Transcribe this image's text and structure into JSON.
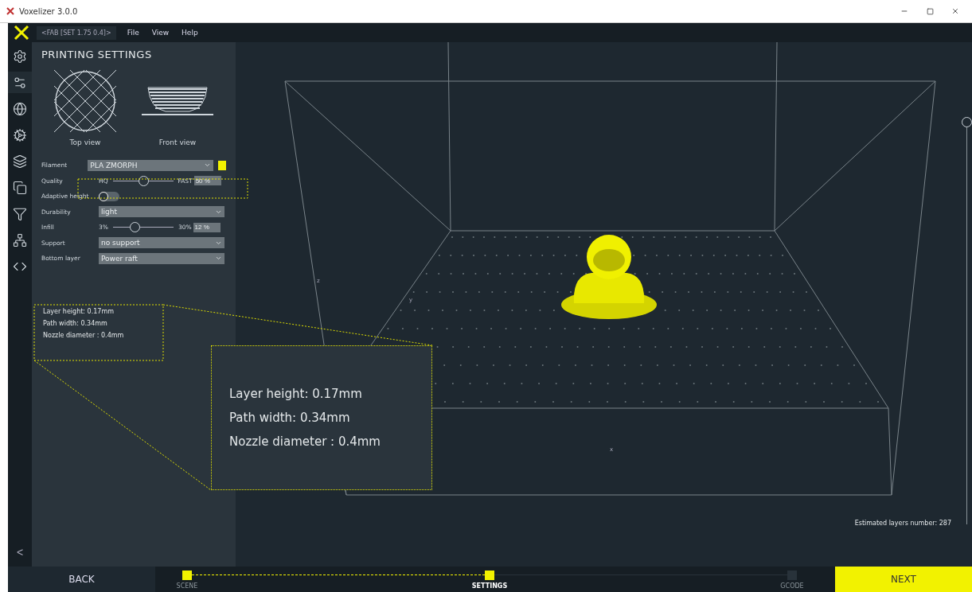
{
  "window": {
    "title": "Voxelizer 3.0.0"
  },
  "menu": {
    "profile": "<FAB [SET 1.75 0.4]>",
    "items": [
      "File",
      "View",
      "Help"
    ]
  },
  "rail": {
    "items": [
      {
        "kind": "gear",
        "selected": false
      },
      {
        "kind": "gear-list",
        "selected": true
      },
      {
        "kind": "globe",
        "selected": false
      },
      {
        "kind": "cogs",
        "selected": false
      },
      {
        "kind": "layers",
        "selected": false
      },
      {
        "kind": "copy",
        "selected": false
      },
      {
        "kind": "filter",
        "selected": false
      },
      {
        "kind": "network",
        "selected": false
      },
      {
        "kind": "code",
        "selected": false
      }
    ],
    "collapse": "<"
  },
  "panel": {
    "title": "PRINTING SETTINGS",
    "previews": [
      "Top view",
      "Front view"
    ],
    "rows": [
      {
        "kind": "select",
        "label": "Filament",
        "value": "PLA ZMORPH",
        "color": "#f2f200"
      },
      {
        "kind": "slider",
        "label": "Quality",
        "min": "HQ",
        "max": "FAST",
        "value": "50 %",
        "level": 0.5
      },
      {
        "kind": "toggle",
        "label": "Adaptive height",
        "on": false
      },
      {
        "kind": "select",
        "label": "Durability",
        "value": "light"
      },
      {
        "kind": "slider",
        "label": "Infill",
        "min": "3%",
        "max": "30%",
        "value": "12 %",
        "level": 0.35
      },
      {
        "kind": "select",
        "label": "Support",
        "value": "no support"
      },
      {
        "kind": "select",
        "label": "Bottom layer",
        "value": "Power raft"
      }
    ],
    "info": [
      "Layer height: 0.17mm",
      "Path width: 0.34mm",
      "Nozzle diameter : 0.4mm"
    ]
  },
  "callout": {
    "lines": [
      "Layer height: 0.17mm",
      "Path width: 0.34mm",
      "Nozzle diameter : 0.4mm"
    ]
  },
  "viewport": {
    "axes": [
      "z",
      "y",
      "x"
    ],
    "estimate": "Estimated layers number: 287",
    "layer_slider": {
      "level": 1
    }
  },
  "footer": {
    "back": "BACK",
    "next": "NEXT",
    "steps": [
      {
        "label": "SCENE",
        "done": true,
        "selected": false
      },
      {
        "label": "SETTINGS",
        "done": true,
        "selected": true
      },
      {
        "label": "GCODE",
        "done": false,
        "selected": false
      }
    ]
  }
}
